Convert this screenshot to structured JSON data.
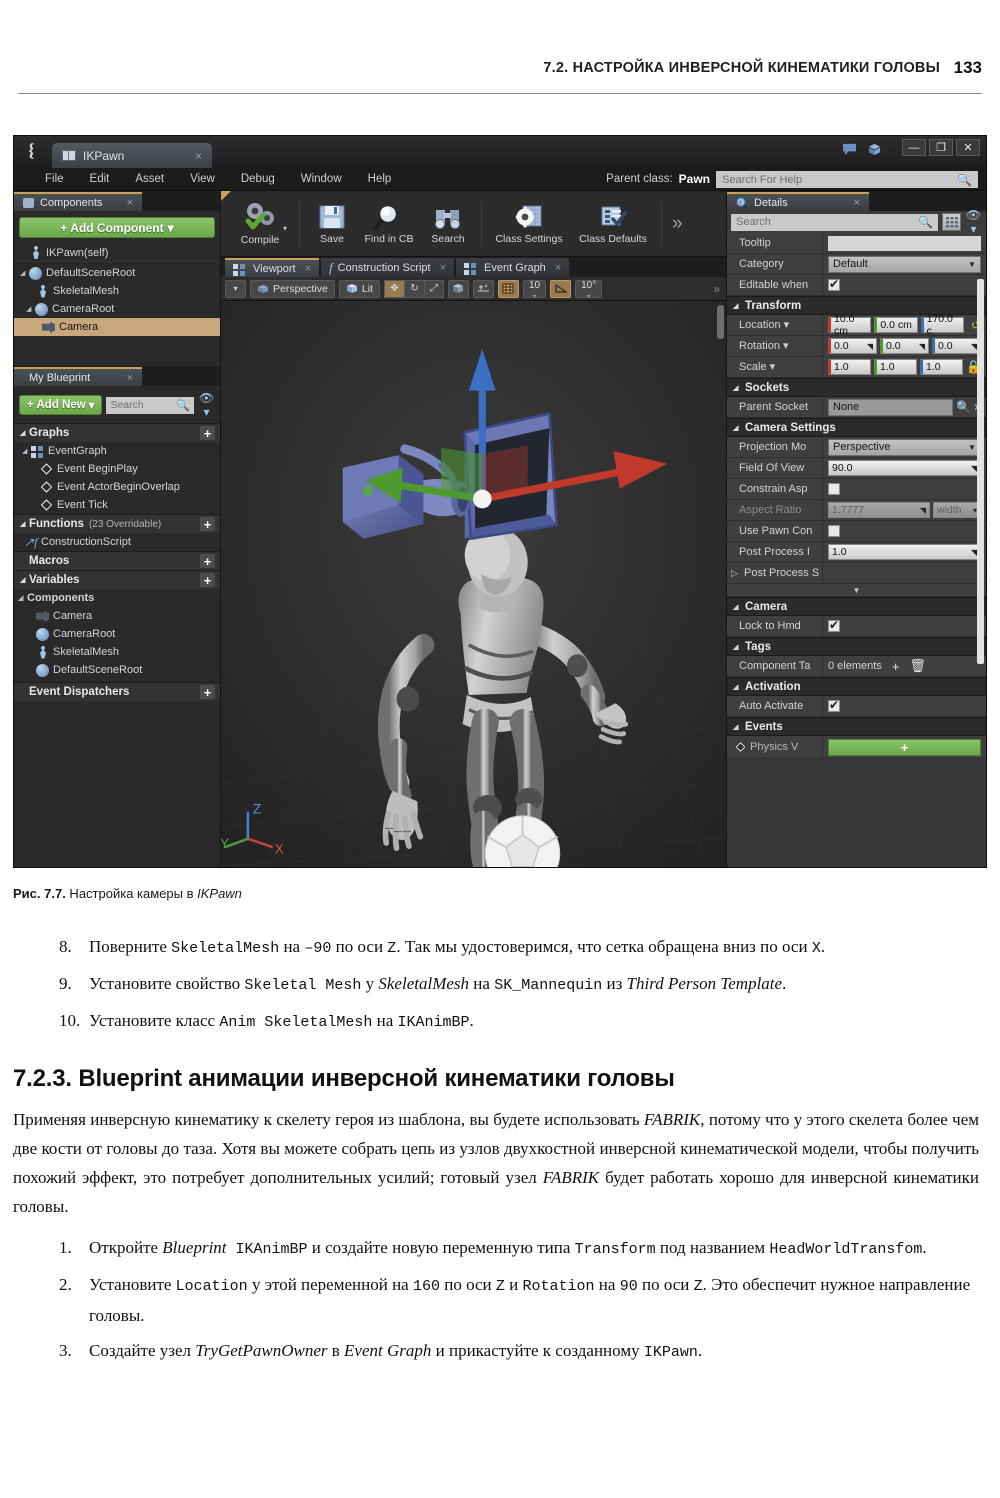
{
  "page": {
    "header_title": "7.2. НАСТРОЙКА ИНВЕРСНОЙ КИНЕМАТИКИ ГОЛОВЫ",
    "page_number": "133"
  },
  "ue_window": {
    "titlebar": {
      "tab_label": "IKPawn",
      "tab_close": "×",
      "minimize": "—",
      "maximize": "❐",
      "close": "✕"
    },
    "menubar": {
      "items": [
        "File",
        "Edit",
        "Asset",
        "View",
        "Debug",
        "Window",
        "Help"
      ],
      "parent_class_label": "Parent class:",
      "parent_class_value": "Pawn",
      "help_search_placeholder": "Search For Help"
    },
    "toolbar": {
      "buttons": [
        {
          "label": "Compile",
          "icon": "compile-gears-icon"
        },
        {
          "label": "Save",
          "icon": "floppy-disk-icon"
        },
        {
          "label": "Find in CB",
          "icon": "magnifier-icon"
        },
        {
          "label": "Search",
          "icon": "binoculars-icon"
        },
        {
          "label": "Class Settings",
          "icon": "gear-window-icon"
        },
        {
          "label": "Class Defaults",
          "icon": "checklist-icon"
        }
      ],
      "overflow": "»"
    },
    "components_panel": {
      "tab_label": "Components",
      "add_button": "+ Add Component",
      "add_caret": "▾",
      "tree": [
        {
          "label": "IKPawn(self)",
          "indent": 0,
          "icon": "pawn-icon",
          "arrow": "",
          "selected": false,
          "separator": true
        },
        {
          "label": "DefaultSceneRoot",
          "indent": 0,
          "icon": "sphere-icon",
          "arrow": "◢",
          "selected": false
        },
        {
          "label": "SkeletalMesh",
          "indent": 1,
          "icon": "skeleton-icon",
          "arrow": "",
          "selected": false
        },
        {
          "label": "CameraRoot",
          "indent": 0,
          "icon": "sphere-icon",
          "arrow": "◢",
          "selected": false
        },
        {
          "label": "Camera",
          "indent": 1,
          "icon": "camera-icon",
          "arrow": "",
          "selected": true
        }
      ]
    },
    "my_blueprint_panel": {
      "tab_label": "My Blueprint",
      "add_new": "+ Add New",
      "add_caret": "▾",
      "search_placeholder": "Search",
      "sections": [
        {
          "title": "Graphs",
          "count": "",
          "arrow": "◢",
          "plus": "+",
          "rows": [
            {
              "label": "EventGraph",
              "indent": 0,
              "icon": "graph-icon",
              "arrow": "◢"
            },
            {
              "label": "Event BeginPlay",
              "indent": 1,
              "icon": "event-diamond-icon",
              "arrow": ""
            },
            {
              "label": "Event ActorBeginOverlap",
              "indent": 1,
              "icon": "event-diamond-icon",
              "arrow": ""
            },
            {
              "label": "Event Tick",
              "indent": 1,
              "icon": "event-diamond-icon",
              "arrow": ""
            }
          ]
        },
        {
          "title": "Functions",
          "count": "(23 Overridable)",
          "arrow": "◢",
          "plus": "+",
          "rows": [
            {
              "label": "ConstructionScript",
              "indent": 0,
              "icon": "function-icon",
              "arrow": ""
            }
          ]
        },
        {
          "title": "Macros",
          "count": "",
          "arrow": "",
          "plus": "+",
          "rows": []
        },
        {
          "title": "Variables",
          "count": "",
          "arrow": "◢",
          "plus": "+",
          "rows": [
            {
              "label": "Components",
              "indent": -1,
              "icon": "",
              "arrow": "◢",
              "subheader": true
            },
            {
              "label": "Camera",
              "indent": 1,
              "icon": "camera-icon",
              "arrow": ""
            },
            {
              "label": "CameraRoot",
              "indent": 1,
              "icon": "sphere-icon",
              "arrow": ""
            },
            {
              "label": "SkeletalMesh",
              "indent": 1,
              "icon": "skeleton-icon",
              "arrow": ""
            },
            {
              "label": "DefaultSceneRoot",
              "indent": 1,
              "icon": "sphere-icon",
              "arrow": ""
            }
          ]
        },
        {
          "title": "Event Dispatchers",
          "count": "",
          "arrow": "",
          "plus": "+",
          "rows": []
        }
      ]
    },
    "viewport": {
      "tabs": [
        {
          "label": "Viewport",
          "icon": "grid-icon",
          "active": true,
          "close": "×"
        },
        {
          "label": "Construction Script",
          "icon": "function-icon",
          "active": false,
          "close": "×"
        },
        {
          "label": "Event Graph",
          "icon": "grid-icon",
          "active": false,
          "close": "×"
        }
      ],
      "toolbar": {
        "menu_caret": "▾",
        "view_mode": "Perspective",
        "lit_mode": "Lit",
        "transform_tools": [
          "move-tool-icon",
          "rotate-tool-icon",
          "scale-tool-icon"
        ],
        "coord_space": "world-space-icon",
        "surface_snap": "surface-snap-icon",
        "grid_snap": "grid-snap-icon",
        "grid_size": "10",
        "angle_snap": "angle-snap-icon",
        "angle_value": "10°",
        "overflow": "»"
      },
      "axis_gizmo": {
        "z": "Z",
        "y": "Y",
        "x": "X"
      }
    },
    "details_panel": {
      "tab_label": "Details",
      "tab_close": "×",
      "search_placeholder": "Search",
      "rows_top": [
        {
          "label": "Tooltip",
          "type": "textbox",
          "value": ""
        },
        {
          "label": "Category",
          "type": "combo",
          "value": "Default"
        },
        {
          "label": "Editable when",
          "type": "checkbox",
          "value": "on"
        }
      ],
      "transform": {
        "title": "Transform",
        "rows": [
          {
            "label": "Location",
            "caret": "▾",
            "values": [
              "10.0 cm",
              "0.0 cm",
              "170.0 c"
            ],
            "reset": "↺"
          },
          {
            "label": "Rotation",
            "caret": "▾",
            "values": [
              "0.0",
              "0.0",
              "0.0"
            ],
            "reset": ""
          },
          {
            "label": "Scale",
            "caret": "▾",
            "values": [
              "1.0",
              "1.0",
              "1.0"
            ],
            "reset": "",
            "lock": "lock-icon"
          }
        ]
      },
      "sockets": {
        "title": "Sockets",
        "label": "Parent Socket",
        "value": "None",
        "browse_icon": "magnifier-icon",
        "clear_icon": "×"
      },
      "camera_settings": {
        "title": "Camera Settings",
        "rows": [
          {
            "label": "Projection Mo",
            "type": "combo",
            "value": "Perspective"
          },
          {
            "label": "Field Of View",
            "type": "spin",
            "value": "90.0"
          },
          {
            "label": "Constrain Asp",
            "type": "checkbox",
            "value": "off"
          },
          {
            "label": "Aspect Ratio",
            "type": "spin-dim",
            "value": "1.7777",
            "value2": "width"
          },
          {
            "label": "Use Pawn Con",
            "type": "checkbox",
            "value": "off"
          },
          {
            "label": "Post Process I",
            "type": "spin",
            "value": "1.0"
          },
          {
            "label": "Post Process S",
            "type": "expander",
            "value": ""
          }
        ]
      },
      "camera_group": {
        "title": "Camera",
        "label": "Lock to Hmd",
        "value": "on"
      },
      "tags": {
        "title": "Tags",
        "label": "Component Ta",
        "value": "0 elements",
        "add": "+",
        "delete": "🗑"
      },
      "activation": {
        "title": "Activation",
        "label": "Auto Activate",
        "value": "on"
      },
      "events": {
        "title": "Events",
        "label": "Physics V",
        "button": "+"
      }
    }
  },
  "figure": {
    "caption_label": "Рис. 7.7.",
    "caption_text": " Настройка камеры в ",
    "caption_italic": "IKPawn"
  },
  "body": {
    "steps_first": [
      {
        "n": "8.",
        "parts": [
          {
            "t": "Поверните ",
            "s": "r"
          },
          {
            "t": "SkeletalMesh",
            "s": "m"
          },
          {
            "t": " на ",
            "s": "r"
          },
          {
            "t": "–90",
            "s": "m"
          },
          {
            "t": " по оси ",
            "s": "r"
          },
          {
            "t": "Z",
            "s": "m"
          },
          {
            "t": ". Так мы удостоверимся, что сетка обращена вниз по оси ",
            "s": "r"
          },
          {
            "t": "X",
            "s": "m"
          },
          {
            "t": ".",
            "s": "r"
          }
        ]
      },
      {
        "n": "9.",
        "parts": [
          {
            "t": "Установите свойство ",
            "s": "r"
          },
          {
            "t": "Skeletal Mesh",
            "s": "m"
          },
          {
            "t": " у ",
            "s": "r"
          },
          {
            "t": "SkeletalMesh",
            "s": "i"
          },
          {
            "t": " на ",
            "s": "r"
          },
          {
            "t": "SK_Mannequin",
            "s": "m"
          },
          {
            "t": " из ",
            "s": "r"
          },
          {
            "t": "Third Person Template",
            "s": "i"
          },
          {
            "t": ".",
            "s": "r"
          }
        ]
      },
      {
        "n": "10.",
        "parts": [
          {
            "t": "Установите класс ",
            "s": "r"
          },
          {
            "t": "Anim SkeletalMesh",
            "s": "m"
          },
          {
            "t": " на ",
            "s": "r"
          },
          {
            "t": "IKAnimBP",
            "s": "m"
          },
          {
            "t": ".",
            "s": "r"
          }
        ]
      }
    ],
    "section_heading": "7.2.3. Blueprint анимации инверсной кинематики головы",
    "paragraph_parts": [
      {
        "t": "Применяя инверсную кинематику к скелету героя из шаблона, вы будете использовать ",
        "s": "r"
      },
      {
        "t": "FABRIK",
        "s": "i"
      },
      {
        "t": ", потому что у этого скелета более чем две кости от головы до таза. Хотя вы можете собрать цепь из узлов двухкостной инверсной кинематической модели, чтобы получить похожий эффект, это потребует дополнительных усилий; готовый узел ",
        "s": "r"
      },
      {
        "t": "FABRIK",
        "s": "i"
      },
      {
        "t": " будет работать хорошо для инверсной кинематики головы.",
        "s": "r"
      }
    ],
    "steps_second": [
      {
        "n": "1.",
        "parts": [
          {
            "t": "Откройте ",
            "s": "r"
          },
          {
            "t": "Blueprint",
            "s": "i"
          },
          {
            "t": " IKAnimBP",
            "s": "m"
          },
          {
            "t": " и создайте новую переменную типа ",
            "s": "r"
          },
          {
            "t": "Transform",
            "s": "m"
          },
          {
            "t": " под названием ",
            "s": "r"
          },
          {
            "t": "HeadWorldTransfom",
            "s": "m"
          },
          {
            "t": ".",
            "s": "r"
          }
        ]
      },
      {
        "n": "2.",
        "parts": [
          {
            "t": "Установите ",
            "s": "r"
          },
          {
            "t": "Location",
            "s": "m"
          },
          {
            "t": " у этой переменной на ",
            "s": "r"
          },
          {
            "t": "160",
            "s": "m"
          },
          {
            "t": " по оси ",
            "s": "r"
          },
          {
            "t": "Z",
            "s": "m"
          },
          {
            "t": " и ",
            "s": "r"
          },
          {
            "t": "Rotation",
            "s": "m"
          },
          {
            "t": " на ",
            "s": "r"
          },
          {
            "t": "90",
            "s": "m"
          },
          {
            "t": " по оси ",
            "s": "r"
          },
          {
            "t": "Z",
            "s": "m"
          },
          {
            "t": ". Это обеспечит нужное направление головы.",
            "s": "r"
          }
        ]
      },
      {
        "n": "3.",
        "parts": [
          {
            "t": "Создайте узел ",
            "s": "r"
          },
          {
            "t": "TryGetPawnOwner",
            "s": "i"
          },
          {
            "t": " в ",
            "s": "r"
          },
          {
            "t": "Event Graph",
            "s": "i"
          },
          {
            "t": " и прикастуйте к созданному ",
            "s": "r"
          },
          {
            "t": "IKPawn",
            "s": "m"
          },
          {
            "t": ".",
            "s": "r"
          }
        ]
      }
    ]
  }
}
